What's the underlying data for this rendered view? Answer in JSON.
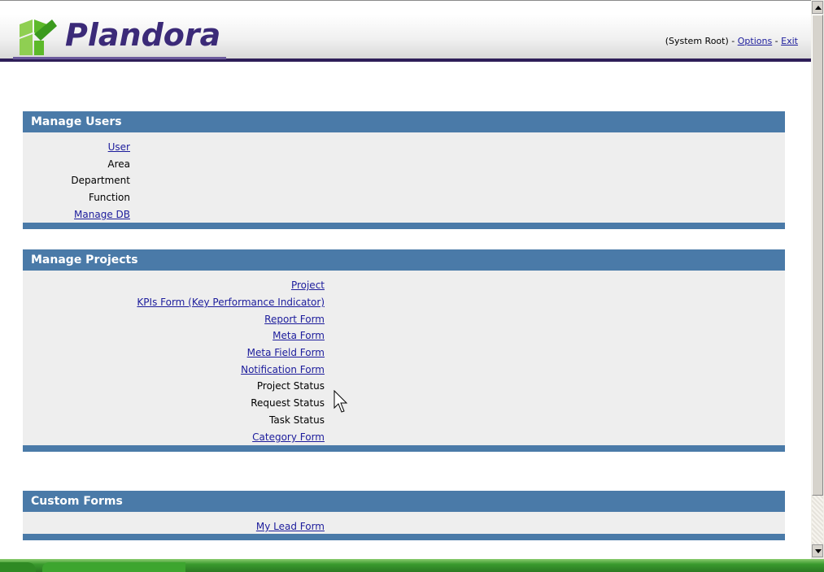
{
  "header": {
    "app_name": "Plandora",
    "user": "(System Root)",
    "separator1": " - ",
    "options_link": "Options",
    "separator2": " - ",
    "exit_link": "Exit"
  },
  "manage_users": {
    "title": "Manage Users",
    "items": [
      "User",
      "Area",
      "Department",
      "Function",
      "Manage DB"
    ]
  },
  "manage_projects": {
    "title": "Manage Projects",
    "items": [
      "Project",
      "KPIs Form (Key Performance Indicator)",
      "Report Form",
      "Meta Form",
      "Meta Field Form",
      "Notification Form",
      "Project Status",
      "Request Status",
      "Task Status",
      "Category Form"
    ]
  },
  "custom_forms": {
    "title": "Custom Forms",
    "items": [
      "My Lead Form"
    ]
  },
  "colors": {
    "section_header": "#4a7aa8",
    "section_body": "#eeeeee",
    "link": "#1c1c9c",
    "visited_link": "#5a1c8a",
    "header_bar": "#2e1e58"
  },
  "icons": {
    "logo": "plandora-logo-icon",
    "cursor": "mouse-pointer-icon"
  }
}
